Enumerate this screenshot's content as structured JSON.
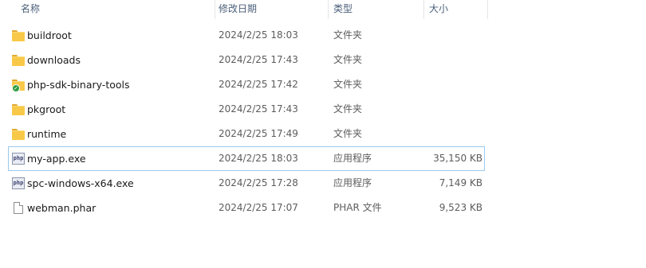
{
  "columns": {
    "name": "名称",
    "modified": "修改日期",
    "type": "类型",
    "size": "大小"
  },
  "sort_indicator": "^",
  "files": [
    {
      "name": "buildroot",
      "modified": "2024/2/25 18:03",
      "type": "文件夹",
      "size": "",
      "icon": "folder-icon"
    },
    {
      "name": "downloads",
      "modified": "2024/2/25 17:43",
      "type": "文件夹",
      "size": "",
      "icon": "folder-icon"
    },
    {
      "name": "php-sdk-binary-tools",
      "modified": "2024/2/25 17:42",
      "type": "文件夹",
      "size": "",
      "icon": "folder-synced-icon"
    },
    {
      "name": "pkgroot",
      "modified": "2024/2/25 17:43",
      "type": "文件夹",
      "size": "",
      "icon": "folder-icon"
    },
    {
      "name": "runtime",
      "modified": "2024/2/25 17:49",
      "type": "文件夹",
      "size": "",
      "icon": "folder-icon"
    },
    {
      "name": "my-app.exe",
      "modified": "2024/2/25 18:03",
      "type": "应用程序",
      "size": "35,150 KB",
      "icon": "php-exe-icon",
      "focused": true
    },
    {
      "name": "spc-windows-x64.exe",
      "modified": "2024/2/25 17:28",
      "type": "应用程序",
      "size": "7,149 KB",
      "icon": "php-exe-icon"
    },
    {
      "name": "webman.phar",
      "modified": "2024/2/25 17:07",
      "type": "PHAR 文件",
      "size": "9,523 KB",
      "icon": "file-icon"
    }
  ],
  "icon_labels": {
    "php": "php",
    "check": "✓"
  },
  "colors": {
    "header_text": "#4c607a",
    "folder": "#f8c948",
    "focus_border": "#99c9ef",
    "sync_badge": "#2f9e44"
  }
}
